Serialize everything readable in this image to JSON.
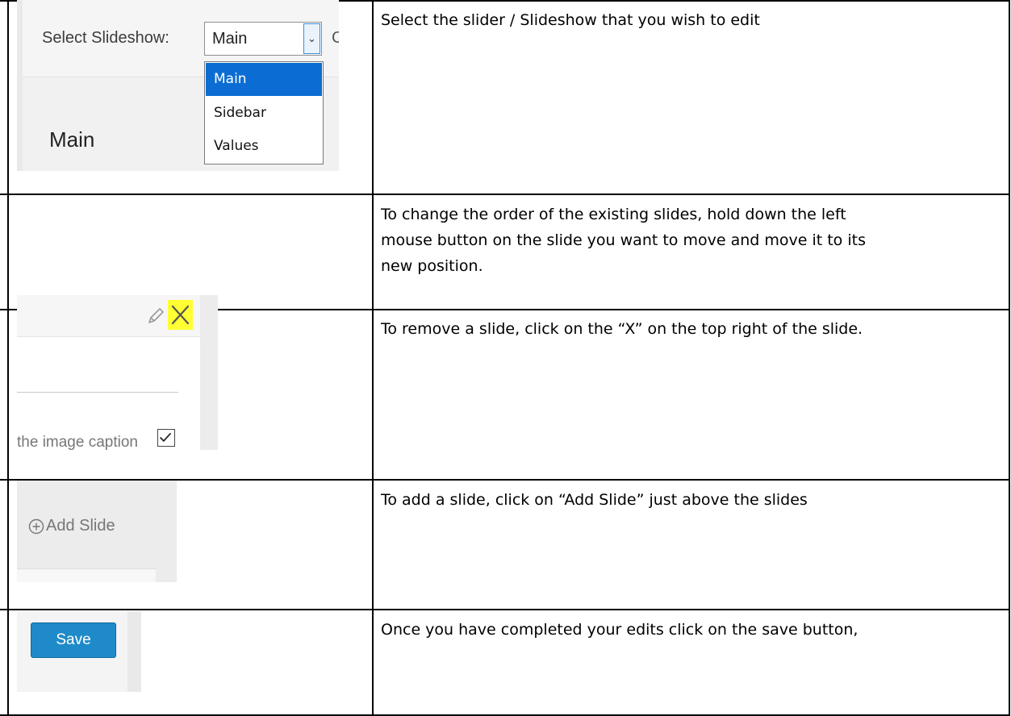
{
  "rows": [
    {
      "description": "Select the slider / Slideshow that you wish to edit",
      "screenshot": {
        "select_label": "Select Slideshow:",
        "selected_value": "Main",
        "cut_text": "C",
        "options": [
          "Main",
          "Sidebar",
          "Values"
        ],
        "heading": "Main"
      }
    },
    {
      "description_lines": [
        "To change the order of the existing slides, hold down the left",
        "mouse button on the slide you want to move and move it to its",
        "new position."
      ]
    },
    {
      "description": "To remove a slide, click on the “X” on the top right of the slide.",
      "screenshot": {
        "caption_text": "the image caption",
        "icons": [
          "pencil-icon",
          "close-icon",
          "checkbox-checked-icon"
        ],
        "highlight_color": "#ffff33"
      }
    },
    {
      "description": "To add a slide, click on “Add Slide” just above the slides",
      "screenshot": {
        "add_label": "Add Slide",
        "icon": "plus-circle-icon"
      }
    },
    {
      "description": "Once you have completed your edits click on the save button,",
      "screenshot": {
        "save_label": "Save",
        "button_color": "#1f8ac9"
      }
    }
  ]
}
